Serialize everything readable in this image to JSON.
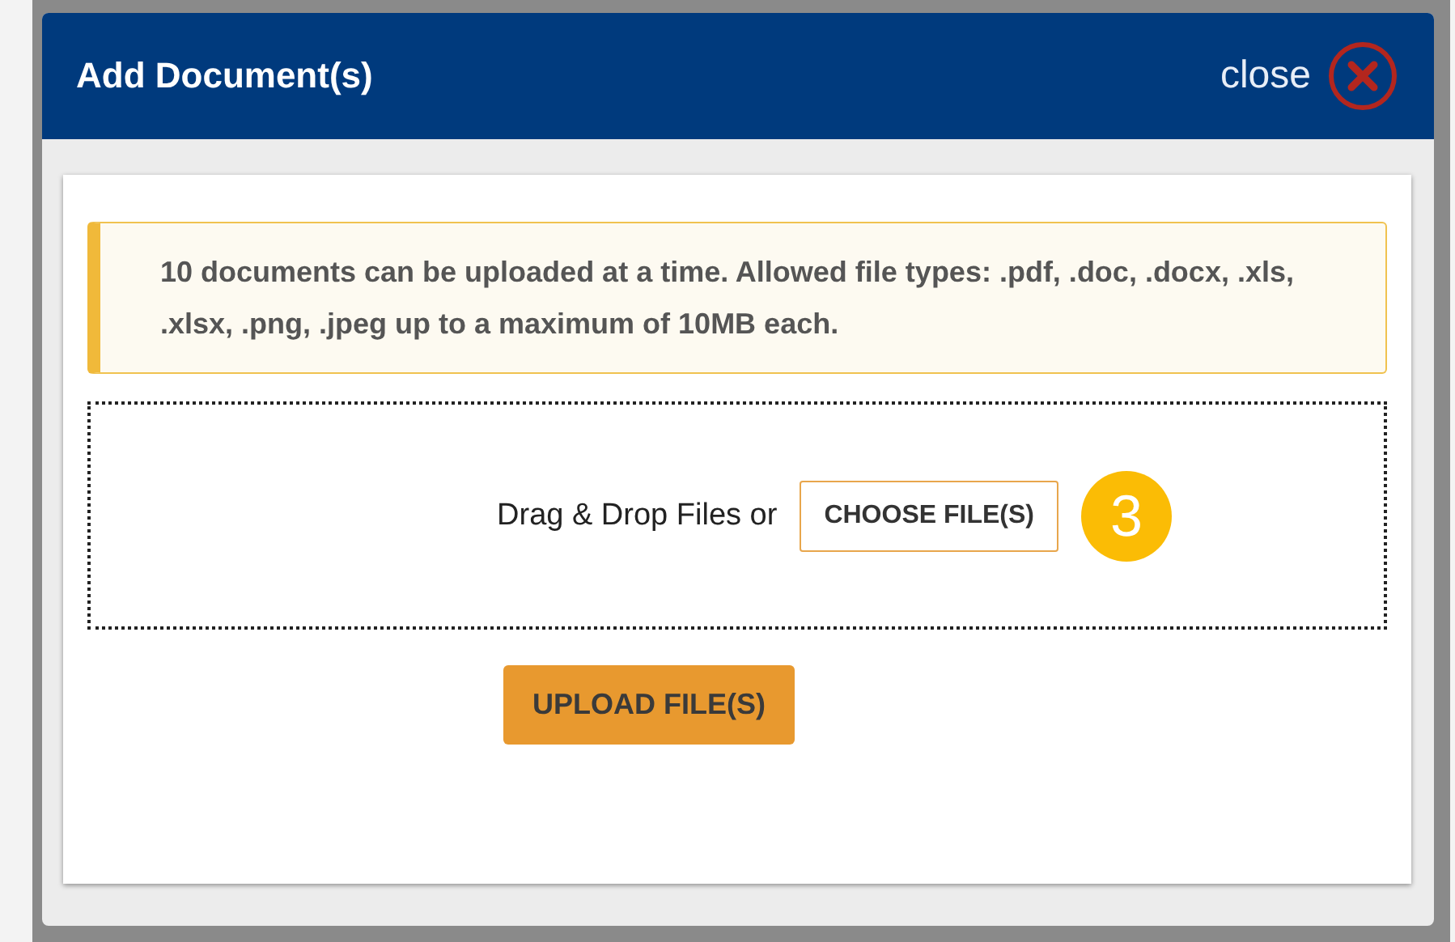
{
  "dialog": {
    "title": "Add Document(s)",
    "close_label": "close"
  },
  "notice": "10 documents can be uploaded at a time. Allowed file types: .pdf, .doc, .docx, .xls, .xlsx, .png, .jpeg up to a maximum of 10MB each.",
  "dropzone": {
    "label": "Drag & Drop Files or",
    "button": "CHOOSE FILE(S)",
    "step_badge": "3"
  },
  "upload_button": "UPLOAD FILE(S)"
}
